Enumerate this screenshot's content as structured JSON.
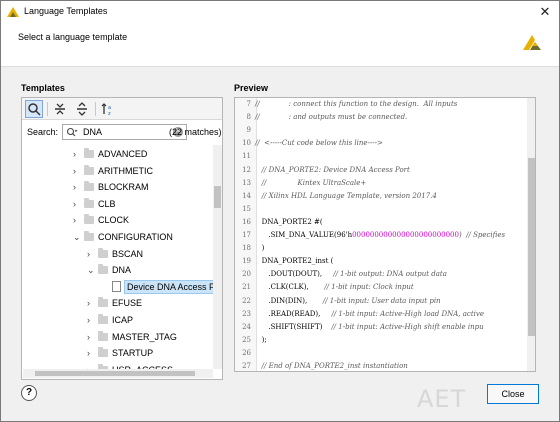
{
  "window": {
    "title": "Language Templates",
    "header_text": "Select a language template"
  },
  "templates_panel": {
    "label": "Templates",
    "search_label": "Search:",
    "search_value": "DNA",
    "match_count": "(22 matches)",
    "tree": [
      {
        "label": "ADVANCED",
        "level": 1,
        "expanded": false
      },
      {
        "label": "ARITHMETIC",
        "level": 1,
        "expanded": false
      },
      {
        "label": "BLOCKRAM",
        "level": 1,
        "expanded": false
      },
      {
        "label": "CLB",
        "level": 1,
        "expanded": false
      },
      {
        "label": "CLOCK",
        "level": 1,
        "expanded": false
      },
      {
        "label": "CONFIGURATION",
        "level": 1,
        "expanded": true
      },
      {
        "label": "BSCAN",
        "level": 2,
        "expanded": false
      },
      {
        "label": "DNA",
        "level": 2,
        "expanded": true
      },
      {
        "label": "Device DNA Access Port",
        "level": 3,
        "leaf": true,
        "selected": true
      },
      {
        "label": "EFUSE",
        "level": 2,
        "expanded": false
      },
      {
        "label": "ICAP",
        "level": 2,
        "expanded": false
      },
      {
        "label": "MASTER_JTAG",
        "level": 2,
        "expanded": false
      },
      {
        "label": "STARTUP",
        "level": 2,
        "expanded": false
      },
      {
        "label": "USR_ACCESS",
        "level": 2,
        "expanded": false
      }
    ]
  },
  "preview_panel": {
    "label": "Preview",
    "lines": [
      {
        "n": "7",
        "text": "//             : connect this function to the design.  All inputs",
        "style": "cm"
      },
      {
        "n": "8",
        "text": "//             : and outputs must be connected.",
        "style": "cm"
      },
      {
        "n": "9",
        "text": "",
        "style": "kw"
      },
      {
        "n": "10",
        "text": "//  <-----Cut code below this line---->",
        "style": "cm"
      },
      {
        "n": "11",
        "text": "",
        "style": "kw"
      },
      {
        "n": "12",
        "text": "   // DNA_PORTE2: Device DNA Access Port",
        "style": "cm"
      },
      {
        "n": "13",
        "text": "   //              Kintex UltraScale+",
        "style": "cm"
      },
      {
        "n": "14",
        "text": "   // Xilinx HDL Language Template, version 2017.4",
        "style": "cm"
      },
      {
        "n": "15",
        "text": "",
        "style": "kw"
      },
      {
        "n": "16",
        "text": "   DNA_PORTE2 #(",
        "style": "kw"
      },
      {
        "n": "17",
        "text": "      .SIM_DNA_VALUE(96'h",
        "num": "000000000000000000000000",
        "after": ")  // Specifies",
        "style": "kw"
      },
      {
        "n": "18",
        "text": "   )",
        "style": "kw"
      },
      {
        "n": "19",
        "text": "   DNA_PORTE2_inst (",
        "style": "kw"
      },
      {
        "n": "20",
        "text": "      .DOUT(DOUT),     ",
        "after": "// 1-bit output: DNA output data",
        "style": "kw"
      },
      {
        "n": "21",
        "text": "      .CLK(CLK),       ",
        "after": "// 1-bit input: Clock input",
        "style": "kw"
      },
      {
        "n": "22",
        "text": "      .DIN(DIN),       ",
        "after": "// 1-bit input: User data input pin",
        "style": "kw"
      },
      {
        "n": "23",
        "text": "      .READ(READ),     ",
        "after": "// 1-bit input: Active-High load DNA, active",
        "style": "kw"
      },
      {
        "n": "24",
        "text": "      .SHIFT(SHIFT)    ",
        "after": "// 1-bit input: Active-High shift enable inpu",
        "style": "kw"
      },
      {
        "n": "25",
        "text": "   );",
        "style": "kw"
      },
      {
        "n": "26",
        "text": "",
        "style": "kw"
      },
      {
        "n": "27",
        "text": "   // End of DNA_PORTE2_inst instantiation",
        "style": "cm"
      }
    ]
  },
  "buttons": {
    "help": "?",
    "close": "Close"
  },
  "watermark": "AET",
  "colors": {
    "accent_border": "#0078d7",
    "selection_bg": "#cce4f7",
    "code_number": "#d700d7",
    "logo_yellow": "#e8b100",
    "logo_dark": "#6d6d2c"
  }
}
